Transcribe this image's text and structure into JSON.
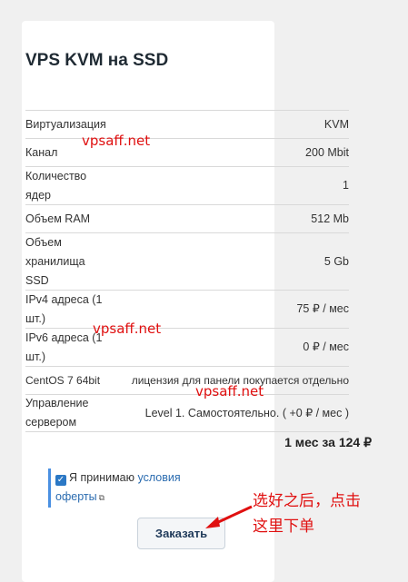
{
  "product": {
    "title": "VPS KVM на SSD"
  },
  "specs": [
    {
      "label": "Виртуализация",
      "value": "KVM"
    },
    {
      "label": "Канал",
      "value": "200 Mbit"
    },
    {
      "label": "Количество ядер",
      "value": "1"
    },
    {
      "label": "Объем RAM",
      "value": "512 Mb"
    },
    {
      "label": "Объем хранилища SSD",
      "value": "5 Gb"
    },
    {
      "label": "IPv4 адреса (1 шт.)",
      "value": "75 ₽ / мес"
    },
    {
      "label": "IPv6 адреса (1 шт.)",
      "value": "0 ₽ / мес"
    },
    {
      "label": "CentOS 7 64bit",
      "value": "лицензия для панели покупается отдельно"
    },
    {
      "label": "Управление сервером",
      "value": "Level 1. Самостоятельно. ( +0 ₽ / мес )"
    }
  ],
  "total": "1 мес за 124 ₽",
  "consent": {
    "text": "Я принимаю",
    "link_1": "условия",
    "link_2": "оферты"
  },
  "order_button": "Заказать",
  "watermarks": [
    "vpsaff.net",
    "vpsaff.net",
    "vpsaff.net"
  ],
  "annotation": {
    "line1": "选好之后，点击",
    "line2": "这里下单"
  },
  "colors": {
    "accent": "#2b78c5",
    "annotation": "#e01010"
  },
  "icons": {
    "checkbox": "checkbox-checked-icon",
    "external": "external-link-icon",
    "arrow": "red-arrow-icon"
  }
}
